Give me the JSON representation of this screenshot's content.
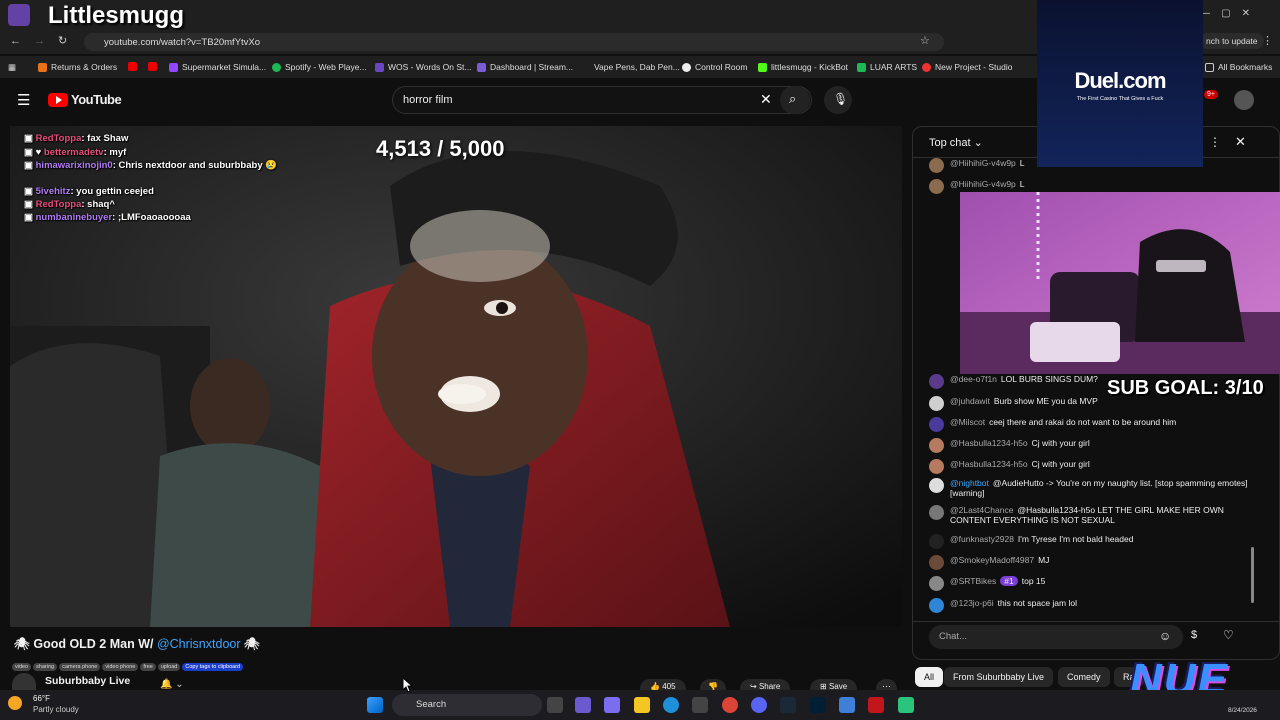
{
  "overlay": {
    "streamer_name": "Littlesmugg",
    "sponsor_brand": "Duel.com",
    "sponsor_tagline": "The First Casino That Gives a Fuck",
    "sub_goal": "SUB GOAL: 3/10",
    "logo_text": "NUE",
    "viewer_counter": "4,513 / 5,000",
    "stream_chat": [
      {
        "user": "RedToppa",
        "msg": ": fax Shaw"
      },
      {
        "user": "bettermadetv",
        "msg": ": myf"
      },
      {
        "user": "himawarixinojin0",
        "msg": ": Chris nextdoor and suburbbaby 😢"
      },
      {
        "user": "5ivehitz",
        "msg": ": you gettin ceejed"
      },
      {
        "user": "RedToppa",
        "msg": ": shaq^"
      },
      {
        "user": "numbaninebuyer",
        "msg": ": ;LMFoaoaoooaa"
      }
    ]
  },
  "browser": {
    "url": "youtube.com/watch?v=TB20mfYtvXo",
    "update_label": "nch to update",
    "bookmarks": [
      "Returns & Orders",
      "Supermarket Simula...",
      "Spotify - Web Playe...",
      "WOS - Words On St...",
      "Dashboard | Stream...",
      "Vape Pens, Dab Pen...",
      "Control Room",
      "littlesmugg - KickBot",
      "LUAR ARTS",
      "New Project - Studio"
    ],
    "all_bookmarks": "All Bookmarks"
  },
  "youtube": {
    "logo": "YouTube",
    "search_value": "horror film",
    "notif_count": "9+",
    "video_title_prefix": "Good OLD 2 Man W/ ",
    "video_title_mention": "@Chrisnxtdoor",
    "tags": [
      "video",
      "sharing",
      "camera phone",
      "video phone",
      "free",
      "upload"
    ],
    "copy_tags": "Copy tags to clipboard",
    "channel_name": "Suburbbaby Live",
    "like_count": "405",
    "share_label": "Share",
    "save_label": "Save",
    "chips": [
      "All",
      "From Suburbbaby Live",
      "Comedy",
      "Ra"
    ]
  },
  "chat": {
    "header": "Top chat",
    "input_placeholder": "Chat...",
    "messages": [
      {
        "author": "@HiihihiG-v4w9p",
        "text": "L",
        "color": "#8b6b4d"
      },
      {
        "author": "@HiihihiG-v4w9p",
        "text": "L",
        "color": "#8b6b4d"
      },
      {
        "author": "@dee-o7f1n",
        "text": "LOL BURB SINGS DUM?",
        "color": "#5b3a8c"
      },
      {
        "author": "@juhdawit",
        "text": "Burb show ME you da MVP",
        "color": "#cfcfcf"
      },
      {
        "author": "@Milscot",
        "text": "ceej there and rakai do not want to be around him",
        "color": "#4a3a9c"
      },
      {
        "author": "@Hasbulla1234-h5o",
        "text": "Cj with your girl",
        "color": "#b57a60"
      },
      {
        "author": "@Hasbulla1234-h5o",
        "text": "Cj with your girl",
        "color": "#b57a60"
      },
      {
        "author": "@nightbot",
        "text": "@AudieHutto -> You're on my naughty list. [stop spamming emotes] [warning]",
        "color": "#dddddd"
      },
      {
        "author": "@2Last4Chance",
        "text": "@Hasbulla1234-h5o LET THE GIRL MAKE HER OWN CONTENT EVERYTHING IS NOT SEXUAL",
        "color": "#777777"
      },
      {
        "author": "@funknasty2928",
        "text": "I'm Tyrese I'm not bald headed",
        "color": "#222222"
      },
      {
        "author": "@SmokeyMadoff4987",
        "text": "MJ",
        "color": "#6b4a3a"
      },
      {
        "author": "@SRTBikes",
        "badge": "#1",
        "text": "top 15",
        "color": "#888888"
      },
      {
        "author": "@123jo-p6i",
        "text": "this not space jam lol",
        "color": "#2f86d6"
      }
    ]
  },
  "taskbar": {
    "weather_temp": "66°F",
    "weather_desc": "Partly cloudy",
    "search_label": "Search",
    "date": "8/24/2026"
  }
}
